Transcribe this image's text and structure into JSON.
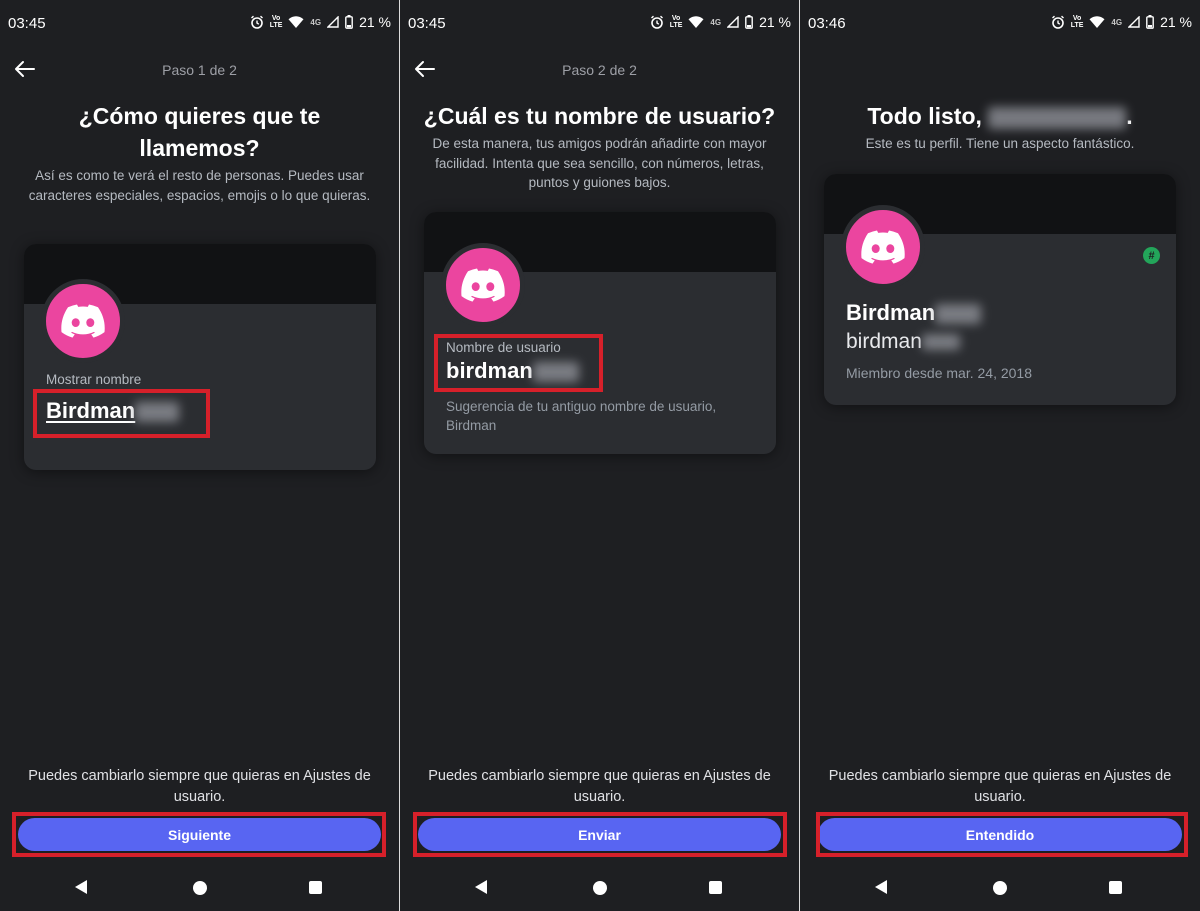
{
  "colors": {
    "background": "#1e1f22",
    "card": "#2b2d31",
    "banner": "#111214",
    "avatar": "#eb459f",
    "button": "#5865f2",
    "highlight_box": "#d6202a",
    "badge": "#23a55a"
  },
  "screen1": {
    "status": {
      "time": "03:45",
      "battery": "21 %",
      "volte": "VoLTE",
      "network": "4G"
    },
    "step": "Paso 1 de 2",
    "title": "¿Cómo quieres que te llamemos?",
    "description": "Así es como te verá el resto de personas. Puedes usar caracteres especiales, espacios, emojis o lo que quieras.",
    "field_label": "Mostrar nombre",
    "field_value": "Birdman",
    "footnote": "Puedes cambiarlo siempre que quieras en Ajustes de usuario.",
    "button": "Siguiente"
  },
  "screen2": {
    "status": {
      "time": "03:45",
      "battery": "21 %",
      "volte": "VoLTE",
      "network": "4G"
    },
    "step": "Paso 2 de 2",
    "title": "¿Cuál es tu nombre de usuario?",
    "description": "De esta manera, tus amigos podrán añadirte con mayor facilidad. Intenta que sea sencillo, con números, letras, puntos y guiones bajos.",
    "field_label": "Nombre de usuario",
    "field_value": "birdman",
    "hint_line1": "Sugerencia de tu antiguo nombre de usuario,",
    "hint_line2": "Birdman",
    "footnote": "Puedes cambiarlo siempre que quieras en Ajustes de usuario.",
    "button": "Enviar"
  },
  "screen3": {
    "status": {
      "time": "03:46",
      "battery": "21 %",
      "volte": "VoLTE",
      "network": "4G"
    },
    "title": "Todo listo,",
    "title_end": ".",
    "subtitle": "Este es tu perfil. Tiene un aspecto fantástico.",
    "display_name": "Birdman",
    "username": "birdman",
    "member_since": "Miembro desde mar. 24, 2018",
    "badge": "#",
    "footnote": "Puedes cambiarlo siempre que quieras en Ajustes de usuario.",
    "button": "Entendido"
  },
  "icons": {
    "back": "arrow-left-icon",
    "avatar": "discord-logo-icon",
    "alarm": "alarm-icon",
    "wifi": "wifi-icon",
    "signal": "signal-icon",
    "battery": "battery-icon"
  }
}
